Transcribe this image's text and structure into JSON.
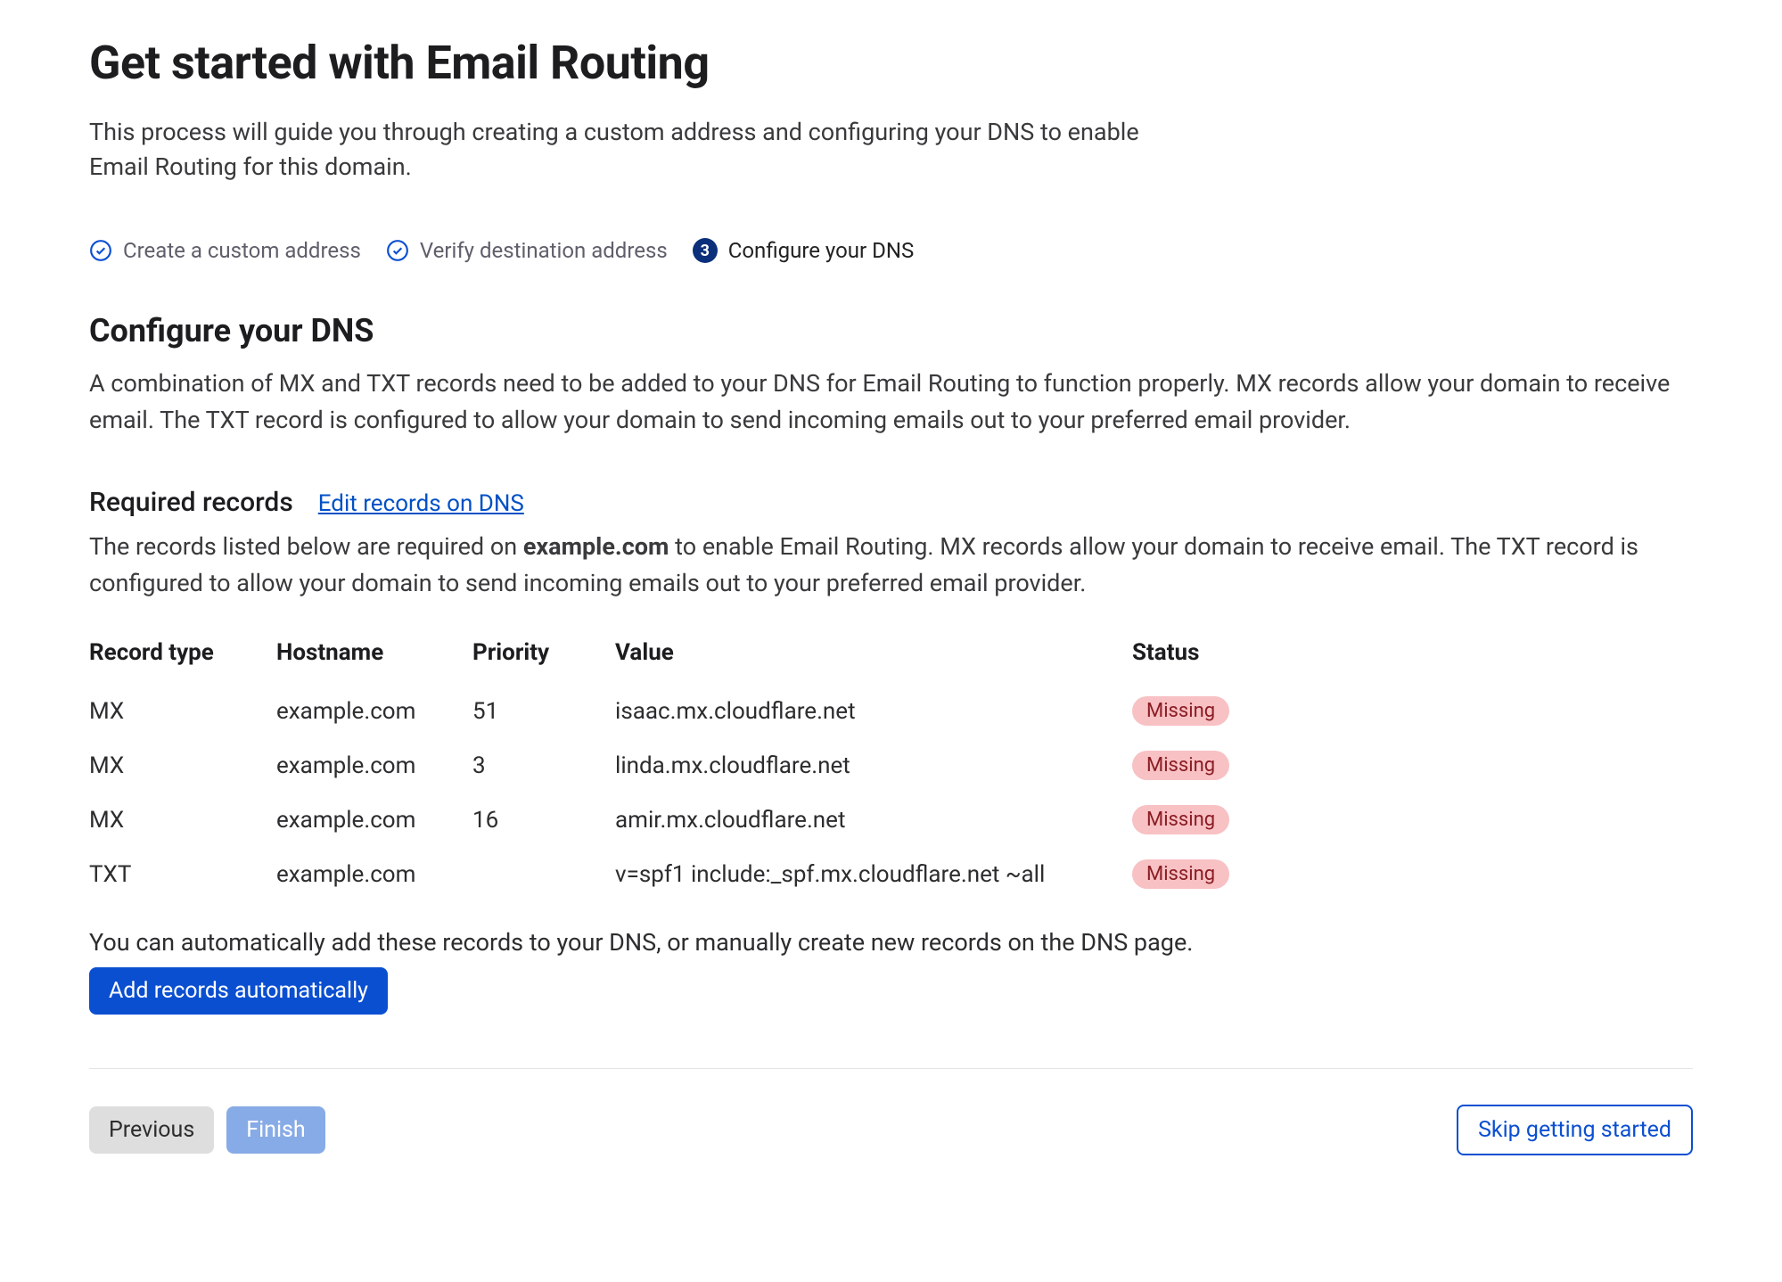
{
  "header": {
    "title": "Get started with Email Routing",
    "intro": "This process will guide you through creating a custom address and configuring your DNS to enable Email Routing for this domain."
  },
  "steps": {
    "items": [
      {
        "label": "Create a custom address",
        "state": "done"
      },
      {
        "label": "Verify destination address",
        "state": "done"
      },
      {
        "label": "Configure your DNS",
        "state": "active",
        "number": "3"
      }
    ]
  },
  "configure": {
    "title": "Configure your DNS",
    "desc": "A combination of MX and TXT records need to be added to your DNS for Email Routing to function properly. MX records allow your domain to receive email. The TXT record is configured to allow your domain to send incoming emails out to your preferred email provider."
  },
  "required": {
    "title": "Required records",
    "edit_link": "Edit records on DNS",
    "desc_prefix": "The records listed below are required on ",
    "domain": "example.com",
    "desc_suffix": " to enable Email Routing. MX records allow your domain to receive email. The TXT record is configured to allow your domain to send incoming emails out to your preferred email provider."
  },
  "table": {
    "headers": {
      "record_type": "Record type",
      "hostname": "Hostname",
      "priority": "Priority",
      "value": "Value",
      "status": "Status"
    },
    "rows": [
      {
        "type": "MX",
        "hostname": "example.com",
        "priority": "51",
        "value": "isaac.mx.cloudflare.net",
        "status": "Missing"
      },
      {
        "type": "MX",
        "hostname": "example.com",
        "priority": "3",
        "value": "linda.mx.cloudflare.net",
        "status": "Missing"
      },
      {
        "type": "MX",
        "hostname": "example.com",
        "priority": "16",
        "value": "amir.mx.cloudflare.net",
        "status": "Missing"
      },
      {
        "type": "TXT",
        "hostname": "example.com",
        "priority": "",
        "value": "v=spf1 include:_spf.mx.cloudflare.net ~all",
        "status": "Missing"
      }
    ]
  },
  "auto": {
    "note": "You can automatically add these records to your DNS, or manually create new records on the DNS page.",
    "button": "Add records automatically"
  },
  "footer": {
    "previous": "Previous",
    "finish": "Finish",
    "skip": "Skip getting started"
  }
}
